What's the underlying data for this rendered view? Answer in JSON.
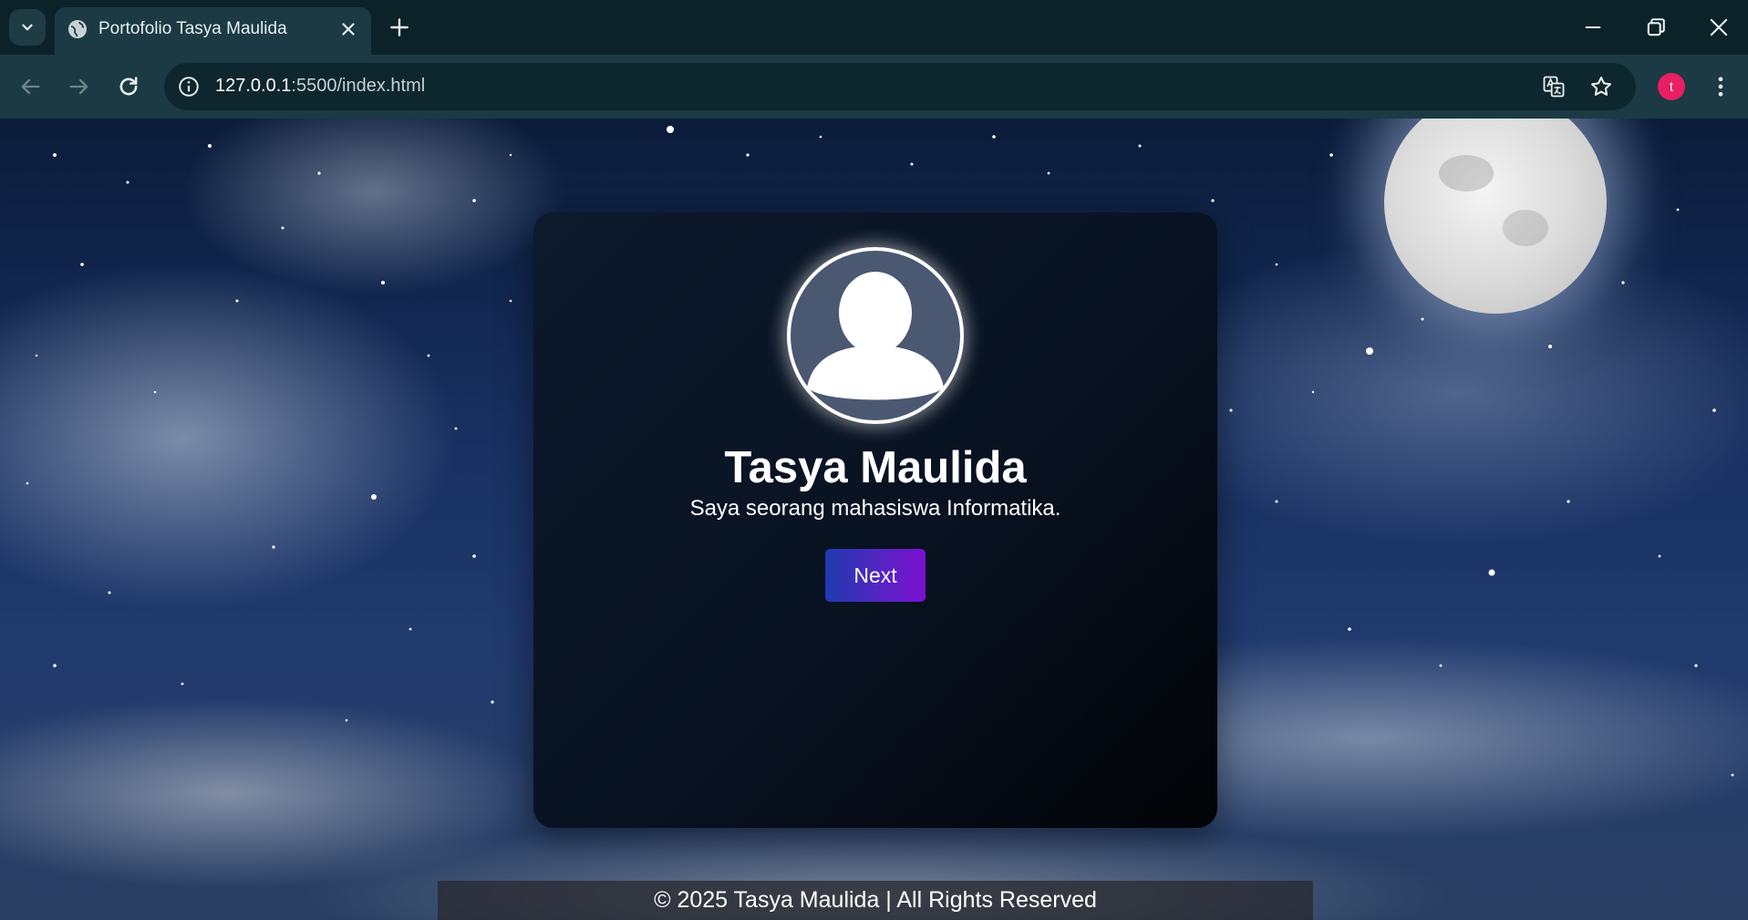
{
  "browser": {
    "tab_title": "Portofolio Tasya Maulida",
    "url_host": "127.0.0.1",
    "url_rest": ":5500/index.html",
    "profile_initial": "t",
    "colors": {
      "tabbar_bg": "#0c2229",
      "toolbar_bg": "#1b3a43",
      "profile_avatar": "#e91e63"
    },
    "icons": [
      "tab-list-icon",
      "globe-icon",
      "close-icon",
      "plus-icon",
      "minimize-icon",
      "restore-icon",
      "window-close-icon",
      "back-icon",
      "forward-icon",
      "reload-icon",
      "info-icon",
      "translate-icon",
      "star-icon",
      "more-vert-icon"
    ]
  },
  "page": {
    "name": "Tasya Maulida",
    "tagline": "Saya seorang mahasiswa Informatika.",
    "next_label": "Next",
    "footer": "© 2025 Tasya Maulida | All Rights Reserved",
    "colors": {
      "card_bg": "#081221",
      "button_start": "#1f3bb0",
      "button_end": "#7a10d0"
    }
  }
}
